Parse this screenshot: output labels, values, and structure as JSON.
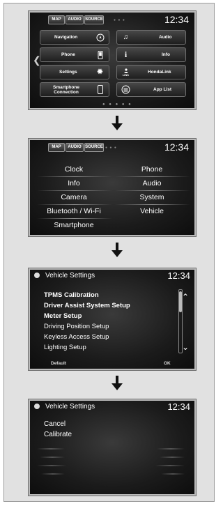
{
  "screen1": {
    "tabs": [
      "MAP",
      "AUDIO",
      "SOURCE"
    ],
    "clock": "12:34",
    "tiles": [
      {
        "label": "Navigation",
        "icon": "compass-icon"
      },
      {
        "label": "Phone",
        "icon": "phone-icon"
      },
      {
        "label": "Settings",
        "icon": "gear-icon"
      },
      {
        "label": "Smartphone Connection",
        "icon": "smartphone-icon"
      },
      {
        "label": "Audio",
        "icon": "music-note-icon"
      },
      {
        "label": "Info",
        "icon": "info-icon"
      },
      {
        "label": "HondaLink",
        "icon": "hondalink-icon"
      },
      {
        "label": "App List",
        "icon": "app-list-icon"
      }
    ],
    "hondalink_icon_text": "LINK"
  },
  "screen2": {
    "tabs": [
      "MAP",
      "AUDIO",
      "SOURCE"
    ],
    "clock": "12:34",
    "left_items": [
      "Clock",
      "Info",
      "Camera",
      "Bluetooth / Wi-Fi",
      "Smartphone"
    ],
    "right_items": [
      "Phone",
      "Audio",
      "System",
      "Vehicle"
    ]
  },
  "screen3": {
    "title": "Vehicle Settings",
    "clock": "12:34",
    "items": [
      "TPMS Calibration",
      "Driver Assist System Setup",
      "Meter Setup",
      "Driving Position Setup",
      "Keyless Access Setup",
      "Lighting Setup"
    ],
    "footer_left": "Default",
    "footer_right": "OK"
  },
  "screen4": {
    "title": "Vehicle Settings",
    "clock": "12:34",
    "items": [
      "Cancel",
      "Calibrate"
    ]
  }
}
